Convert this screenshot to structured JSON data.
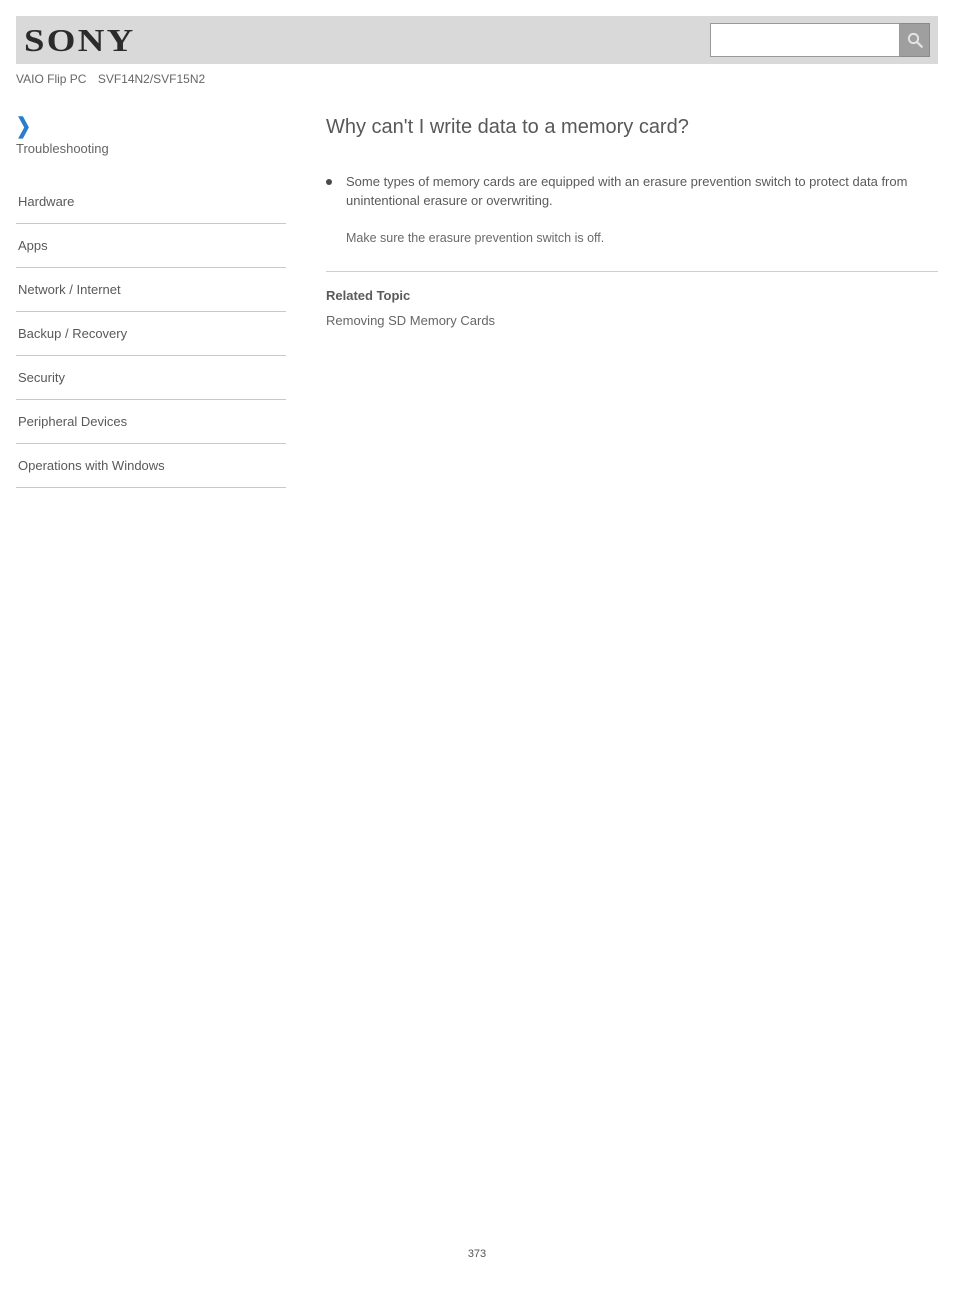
{
  "header": {
    "logo_text": "SONY",
    "search_value": "",
    "search_placeholder": ""
  },
  "product": {
    "series": "VAIO Flip PC",
    "model": "SVF14N2/SVF15N2"
  },
  "sidebar": {
    "trouble_link": "Troubleshooting",
    "items": [
      "Hardware",
      "Apps",
      "Network / Internet",
      "Backup / Recovery",
      "Security",
      "Peripheral Devices",
      "Operations with Windows"
    ]
  },
  "article": {
    "title": "Why can't I write data to a memory card?",
    "bullet": "Some types of memory cards are equipped with an erasure prevention switch to protect data from unintentional erasure or overwriting.",
    "sub": "Make sure the erasure prevention switch is off.",
    "related_heading": "Related Topic",
    "related_link": "Removing SD Memory Cards"
  },
  "page_number": "373"
}
